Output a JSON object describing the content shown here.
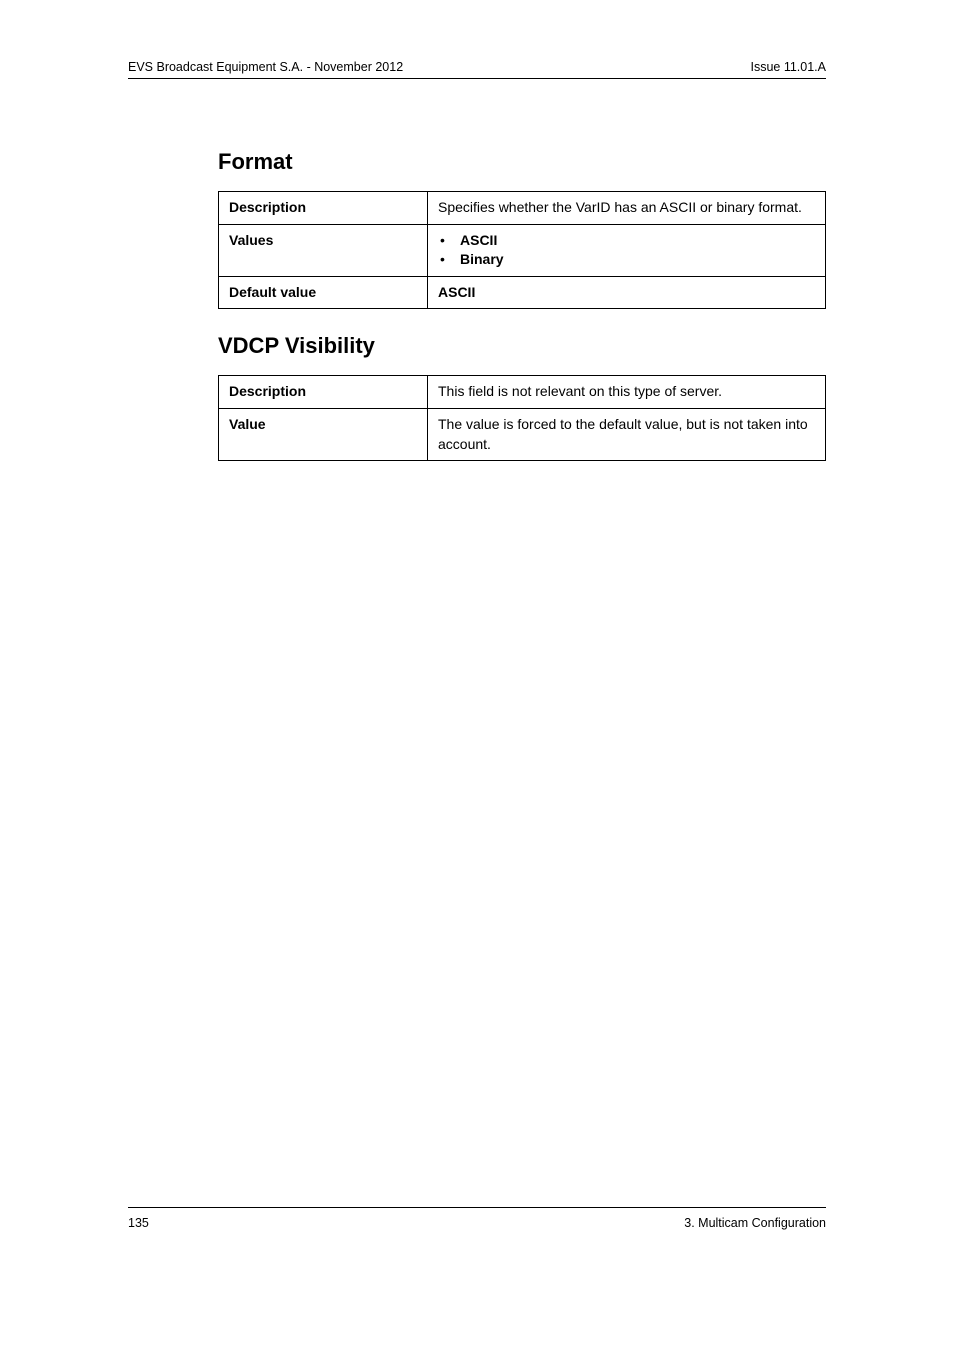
{
  "header": {
    "left": "EVS Broadcast Equipment S.A.  - November 2012",
    "right": "Issue 11.01.A"
  },
  "section1": {
    "title": "Format",
    "rows": {
      "desc_label": "Description",
      "desc_value": "Specifies whether the VarID has an ASCII or binary format.",
      "values_label": "Values",
      "values_items": [
        "ASCII",
        "Binary"
      ],
      "default_label": "Default value",
      "default_value": "ASCII"
    }
  },
  "section2": {
    "title": "VDCP Visibility",
    "rows": {
      "desc_label": "Description",
      "desc_value": "This field is not relevant on this type of server.",
      "value_label": "Value",
      "value_value": "The value is forced to the default value, but is not taken into account."
    }
  },
  "footer": {
    "page_number": "135",
    "chapter": "3. Multicam Configuration"
  }
}
